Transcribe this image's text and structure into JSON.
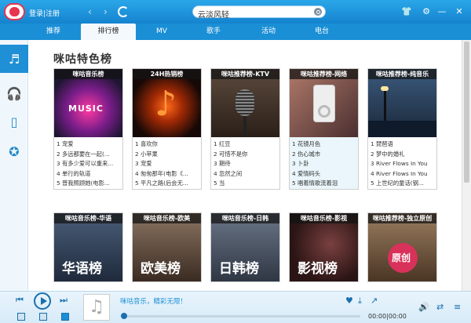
{
  "app": {
    "login_register": "登录|注册",
    "search_value": "云淡风轻"
  },
  "nav": {
    "tabs": [
      "推荐",
      "排行榜",
      "MV",
      "歌手",
      "活动",
      "电台"
    ],
    "active": 1
  },
  "section": {
    "title": "咪咕特色榜"
  },
  "charts_row1": [
    {
      "title": "咪咕音乐榜",
      "art": "MUSIC",
      "bg": "#1f1633",
      "songs": [
        "1 宠爱",
        "2 多远都要在一起(...",
        "3 有多少爱可以重来...",
        "4 单行的轨道",
        "5 普我照顾她(电影..."
      ]
    },
    {
      "title": "24H热销榜",
      "art": "♪",
      "bg": "#160806",
      "songs": [
        "1 喜欢你",
        "2 小苹果",
        "3 宠爱",
        "4 匆匆那年(电影《...",
        "5 平凡之路(后会无..."
      ]
    },
    {
      "title": "咪咕推荐榜-KTV",
      "art": "",
      "bg": "#3a2b22",
      "songs": [
        "1 红豆",
        "2 可惜不是你",
        "3 期待",
        "4 忽然之间",
        "5 当"
      ]
    },
    {
      "title": "咪咕推荐榜-网络",
      "art": "",
      "bg": "#5a3f3c",
      "songs": [
        "1 花镜月色",
        "2 伤心城市",
        "3 卜卦",
        "4 爱情码头",
        "5 唱着情歌流着泪"
      ]
    },
    {
      "title": "咪咕推荐榜-纯音乐",
      "art": "",
      "bg": "#243a55",
      "songs": [
        "1 琵琶语",
        "2 梦中的婚礼",
        "3 River Flows In You",
        "4 River Flows In You",
        "5 上世纪的童话(钢..."
      ]
    }
  ],
  "charts_row2": [
    {
      "title": "咪咕音乐榜-华语",
      "art": "华语榜",
      "bg": "#2c3a52"
    },
    {
      "title": "咪咕音乐榜-欧美",
      "art": "欧美榜",
      "bg": "#5a4538"
    },
    {
      "title": "咪咕音乐榜-日韩",
      "art": "日韩榜",
      "bg": "#4a5566"
    },
    {
      "title": "咪咕音乐榜-影视",
      "art": "影视榜",
      "bg": "#3a1e1e"
    },
    {
      "title": "咪咕推荐榜-独立原创",
      "art": "原创",
      "bg": "#6a5140"
    }
  ],
  "player": {
    "song_text": "咪咕音乐，精彩无限！",
    "time": "00:00|00:00"
  }
}
